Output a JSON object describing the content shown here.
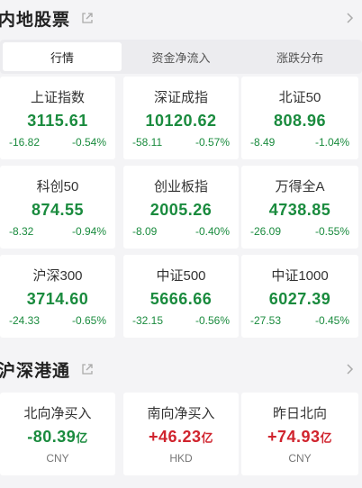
{
  "sections": {
    "domestic": {
      "title": "内地股票"
    },
    "connect": {
      "title": "沪深港通"
    }
  },
  "tabs": [
    "行情",
    "资金净流入",
    "涨跌分布"
  ],
  "indices": [
    {
      "name": "上证指数",
      "price": "3115.61",
      "change": "-16.82",
      "pct": "-0.54%"
    },
    {
      "name": "深证成指",
      "price": "10120.62",
      "change": "-58.11",
      "pct": "-0.57%"
    },
    {
      "name": "北证50",
      "price": "808.96",
      "change": "-8.49",
      "pct": "-1.04%"
    },
    {
      "name": "科创50",
      "price": "874.55",
      "change": "-8.32",
      "pct": "-0.94%"
    },
    {
      "name": "创业板指",
      "price": "2005.26",
      "change": "-8.09",
      "pct": "-0.40%"
    },
    {
      "name": "万得全A",
      "price": "4738.85",
      "change": "-26.09",
      "pct": "-0.55%"
    },
    {
      "name": "沪深300",
      "price": "3714.60",
      "change": "-24.33",
      "pct": "-0.65%"
    },
    {
      "name": "中证500",
      "price": "5666.66",
      "change": "-32.15",
      "pct": "-0.56%"
    },
    {
      "name": "中证1000",
      "price": "6027.39",
      "change": "-27.53",
      "pct": "-0.45%"
    }
  ],
  "flows": [
    {
      "name": "北向净买入",
      "value": "-80.39",
      "unit_label": "亿",
      "currency": "CNY"
    },
    {
      "name": "南向净买入",
      "value": "+46.23",
      "unit_label": "亿",
      "currency": "HKD"
    },
    {
      "name": "昨日北向",
      "value": "+74.93",
      "unit_label": "亿",
      "currency": "CNY"
    }
  ],
  "colors": {
    "up": "#d0242e",
    "down": "#1a8b3e"
  },
  "chart_data": {
    "type": "table",
    "columns": [
      "name",
      "price",
      "change",
      "pct"
    ],
    "rows": [
      [
        "上证指数",
        3115.61,
        -16.82,
        -0.54
      ],
      [
        "深证成指",
        10120.62,
        -58.11,
        -0.57
      ],
      [
        "北证50",
        808.96,
        -8.49,
        -1.04
      ],
      [
        "科创50",
        874.55,
        -8.32,
        -0.94
      ],
      [
        "创业板指",
        2005.26,
        -8.09,
        -0.4
      ],
      [
        "万得全A",
        4738.85,
        -26.09,
        -0.55
      ],
      [
        "沪深300",
        3714.6,
        -24.33,
        -0.65
      ],
      [
        "中证500",
        5666.66,
        -32.15,
        -0.56
      ],
      [
        "中证1000",
        6027.39,
        -27.53,
        -0.45
      ]
    ],
    "flows": [
      [
        "北向净买入",
        -80.39,
        "CNY"
      ],
      [
        "南向净买入",
        46.23,
        "HKD"
      ],
      [
        "昨日北向",
        74.93,
        "CNY"
      ]
    ]
  }
}
